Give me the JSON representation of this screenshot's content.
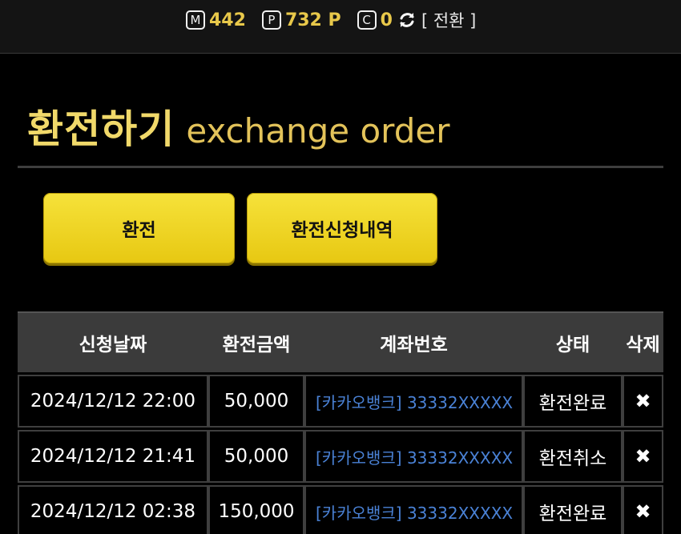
{
  "topbar": {
    "money_icon": "M",
    "money_value": "442",
    "point_icon": "P",
    "point_value": "732 P",
    "coin_icon": "C",
    "coin_value": "0",
    "switch_label": "[ 전환 ]"
  },
  "heading": {
    "title_ko": "환전하기",
    "title_en": "exchange order"
  },
  "buttons": {
    "exchange": "환전",
    "history": "환전신청내역"
  },
  "table": {
    "headers": [
      "신청날짜",
      "환전금액",
      "계좌번호",
      "상태",
      "삭제"
    ],
    "rows": [
      {
        "date": "2024/12/12 22:00",
        "amount": "50,000",
        "account": "[카카오뱅크] 33332XXXXX",
        "status": "환전완료",
        "delete": "✖"
      },
      {
        "date": "2024/12/12 21:41",
        "amount": "50,000",
        "account": "[카카오뱅크] 33332XXXXX",
        "status": "환전취소",
        "delete": "✖"
      },
      {
        "date": "2024/12/12 02:38",
        "amount": "150,000",
        "account": "[카카오뱅크] 33332XXXXX",
        "status": "환전완료",
        "delete": "✖"
      }
    ]
  },
  "colors": {
    "accent_gold": "#e8c84a",
    "button_yellow": "#f0d620",
    "link_blue": "#4a82d6"
  }
}
